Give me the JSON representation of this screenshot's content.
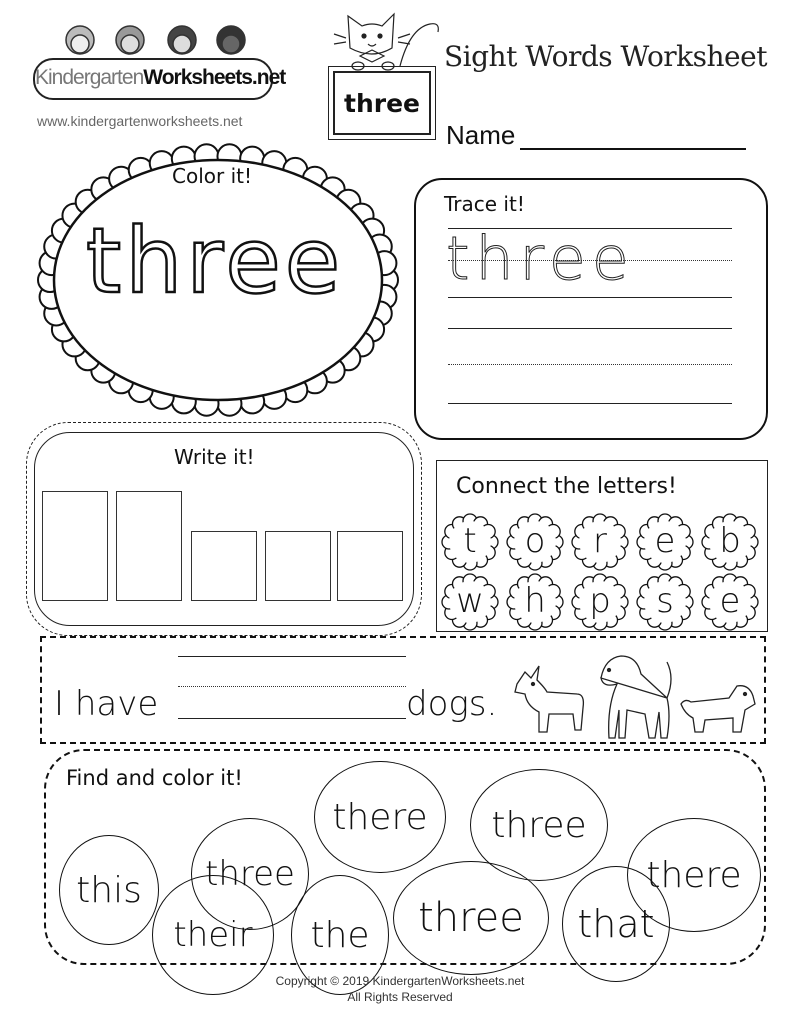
{
  "header": {
    "logo_part1": "Kindergarten",
    "logo_part2": "Worksheets.net",
    "site_url": "www.kindergartenworksheets.net",
    "title": "Sight Words Worksheet",
    "sight_word": "three",
    "name_label": "Name"
  },
  "color_it": {
    "label": "Color it!",
    "word": "three"
  },
  "trace_it": {
    "label": "Trace it!",
    "word": "three"
  },
  "write_it": {
    "label": "Write it!",
    "box_count": 5
  },
  "connect": {
    "label": "Connect the letters!",
    "row1": [
      "t",
      "o",
      "r",
      "e",
      "b"
    ],
    "row2": [
      "w",
      "h",
      "p",
      "s",
      "e"
    ]
  },
  "sentence": {
    "prefix": "I have",
    "suffix": "dogs.",
    "dog_count": 3
  },
  "find_it": {
    "label": "Find and color it!",
    "words": [
      "there",
      "three",
      "this",
      "three",
      "there",
      "their",
      "the",
      "three",
      "that"
    ]
  },
  "footer": {
    "line1": "Copyright © 2019 KindergartenWorksheets.net",
    "line2": "All Rights Reserved"
  }
}
